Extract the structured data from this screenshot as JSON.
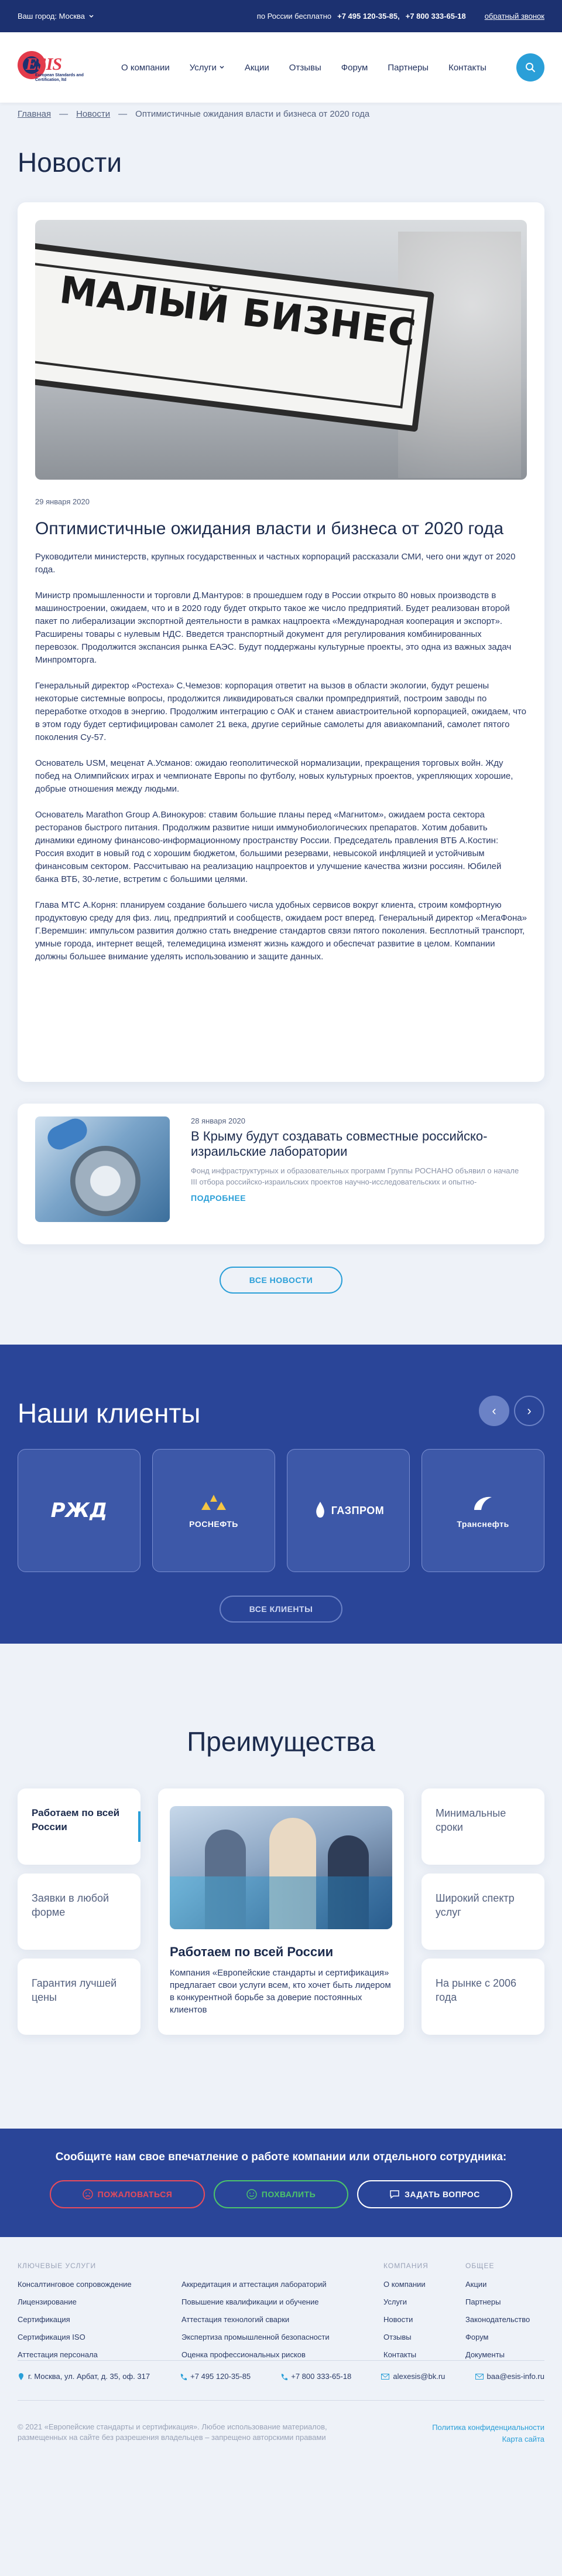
{
  "topbar": {
    "city": "Ваш город: Москва",
    "free_label": "по России бесплатно",
    "phone1": "+7 495 120-35-85,",
    "phone2": "+7 800 333-65-18",
    "callback": "обратный звонок"
  },
  "logo": {
    "text": "ESIS",
    "subtitle": "European Standards and Certification, ltd"
  },
  "nav": {
    "items": [
      "О компании",
      "Услуги",
      "Акции",
      "Отзывы",
      "Форум",
      "Партнеры",
      "Контакты"
    ]
  },
  "breadcrumb": {
    "home": "Главная",
    "news": "Новости",
    "current": "Оптимистичные ожидания власти и бизнеса от 2020 года"
  },
  "page_title": "Новости",
  "article": {
    "image_text": "МАЛЫЙ БИЗНЕС",
    "date": "29 января 2020",
    "title": "Оптимистичные ожидания власти и бизнеса от 2020 года",
    "lead": "Руководители министерств, крупных государственных и частных корпораций рассказали СМИ, чего они ждут от 2020 года.",
    "paragraphs": [
      "Министр промышленности и торговли Д.Мантуров: в прошедшем году в России открыто 80 новых производств в машиностроении, ожидаем, что и в 2020 году будет открыто такое же число предприятий. Будет реализован второй пакет по либерализации экспортной деятельности в рамках нацпроекта «Международная кооперация и экспорт». Расширены товары с нулевым НДС. Введется транспортный документ для регулирования комбинированных перевозок. Продолжится экспансия рынка ЕАЭС. Будут поддержаны культурные проекты, это одна из важных задач Минпромторга.",
      "Генеральный директор «Ростеха» С.Чемезов: корпорация ответит на вызов в области экологии, будут решены некоторые системные вопросы, продолжится ликвидироваться свалки промпредприятий, построим заводы по переработке отходов в энергию. Продолжим интеграцию с ОАК и станем авиастроительной корпорацией, ожидаем, что в этом году будет сертифицирован самолет 21 века, другие серийные самолеты для авиакомпаний, самолет пятого поколения Су-57.",
      "Основатель USM, меценат А.Усманов: ожидаю геополитической нормализации, прекращения торговых войн. Жду побед на Олимпийских играх и чемпионате Европы по футболу, новых культурных проектов, укрепляющих хорошие, добрые отношения между людьми.",
      "Основатель Marathon Group А.Винокуров: ставим большие планы перед «Магнитом», ожидаем роста сектора ресторанов быстрого питания. Продолжим развитие ниши иммунобиологических препаратов. Хотим добавить динамики единому финансово-информационному пространству России. Председатель правления ВТБ А.Костин: Россия входит в новый год с хорошим бюджетом, большими резервами, невысокой инфляцией и устойчивым финансовым сектором. Рассчитываю на реализацию нацпроектов и улучшение качества жизни россиян. Юбилей банка ВТБ, 30-летие, встретим с большими целями.",
      "Глава МТС А.Корня: планируем создание большего числа удобных сервисов вокруг клиента, строим комфортную продуктовую среду для физ. лиц, предприятий и сообществ, ожидаем рост вперед. Генеральный директор «МегаФона» Г.Веремшин: импульсом развития должно стать внедрение стандартов связи пятого поколения. Бесплотный транспорт, умные города, интернет вещей, телемедицина изменят жизнь каждого и обеспечат развитие в целом. Компании должны большее внимание уделять использованию и защите данных."
    ]
  },
  "related": {
    "date": "28 января 2020",
    "title": "В Крыму будут создавать совместные российско-израильские лаборатории",
    "text": "Фонд инфраструктурных и образовательных программ Группы РОСНАНО объявил о начале III отбора российско-израильских проектов научно-исследовательских и опытно-конструкторских работ (НИОКР) в области нанотехнологий и высокотех...",
    "more": "ПОДРОБНЕЕ"
  },
  "all_news_button": "ВСЕ НОВОСТИ",
  "clients": {
    "title": "Наши клиенты",
    "items": [
      {
        "mark": "РЖД",
        "name": ""
      },
      {
        "mark": "",
        "name": "РОСНЕФТЬ"
      },
      {
        "mark": "",
        "name": "ГАЗПРОМ"
      },
      {
        "mark": "",
        "name": "Транснефть"
      }
    ],
    "all_button": "ВСЕ КЛИЕНТЫ",
    "prev": "‹",
    "next": "›"
  },
  "advantages": {
    "title": "Преимущества",
    "tiles": [
      "Работаем по всей России",
      "Заявки в любой форме",
      "Гарантия лучшей цены",
      "Минимальные сроки",
      "Широкий спектр услуг",
      "На рынке с 2006 года"
    ],
    "active_title": "Работаем по всей России",
    "active_text": "Компания «Европейские стандарты и сертификация» предлагает свои услуги всем, кто хочет быть лидером в конкурентной борьбе за доверие постоянных клиентов"
  },
  "feedback": {
    "title": "Сообщите нам свое впечатление о работе компании или отдельного сотрудника:",
    "complain": "ПОЖАЛОВАТЬСЯ",
    "praise": "ПОХВАЛИТЬ",
    "ask": "ЗАДАТЬ ВОПРОС"
  },
  "footer": {
    "services_head": "КЛЮЧЕВЫЕ УСЛУГИ",
    "services_col1": [
      "Консалтинговое сопровождение",
      "Лицензирование",
      "Сертификация",
      "Сертификация ISO",
      "Аттестация персонала"
    ],
    "services_col2": [
      "Аккредитация и аттестация лабораторий",
      "Повышение квалификации и обучение",
      "Аттестация технологий сварки",
      "Экспертиза промышленной безопасности",
      "Оценка профессиональных рисков"
    ],
    "company_head": "КОМПАНИЯ",
    "company": [
      "О компании",
      "Услуги",
      "Новости",
      "Отзывы",
      "Контакты"
    ],
    "general_head": "ОБЩЕЕ",
    "general": [
      "Акции",
      "Партнеры",
      "Законодательство",
      "Форум",
      "Документы"
    ],
    "address": "г. Москва, ул. Арбат, д. 35, оф. 317",
    "phone1": "+7 495 120-35-85",
    "phone2": "+7 800 333-65-18",
    "email1": "alexesis@bk.ru",
    "email2": "baa@esis-info.ru",
    "copyright": "© 2021 «Европейские стандарты и сертификация». Любое использование материалов, размещенных на сайте без разрешения владельцев – запрещено авторскими правами",
    "privacy": "Политика конфиденциальности",
    "sitemap": "Карта сайта"
  }
}
